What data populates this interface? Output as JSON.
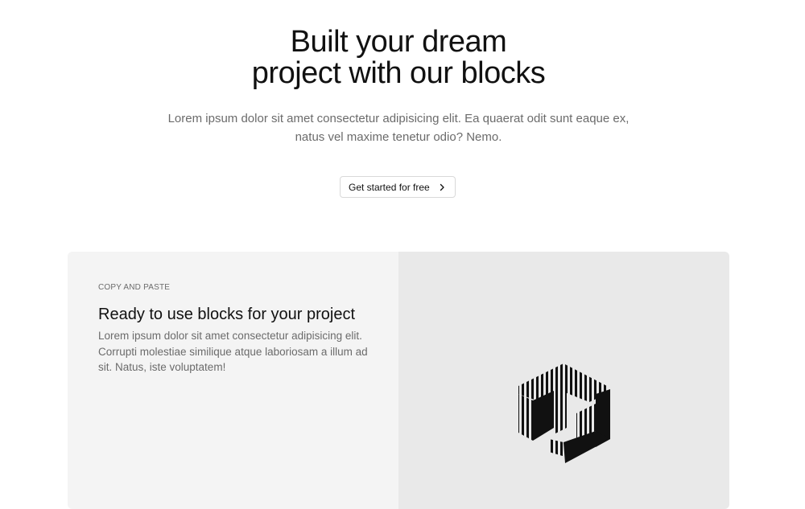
{
  "hero": {
    "title_line1": "Built your dream",
    "title_line2": "project with our blocks",
    "description_line1": "Lorem ipsum dolor sit amet consectetur adipisicing elit. Ea quaerat odit sunt eaque ex,",
    "description_line2": "natus vel maxime tenetur odio? Nemo.",
    "cta_label": "Get started for free",
    "cta_icon": "chevron-right-icon"
  },
  "feature": {
    "eyebrow": "COPY AND PASTE",
    "title": "Ready to use blocks for your project",
    "description": "Lorem ipsum dolor sit amet consectetur adipisicing elit. Corrupti molestiae similique atque laboriosam a illum ad sit. Natus, iste voluptatem!",
    "illustration_icon": "striped-cube-logo-icon"
  },
  "colors": {
    "text_primary": "#111111",
    "text_muted": "#6b6b6b",
    "panel_left": "#f4f4f4",
    "panel_right": "#e9e9e9",
    "button_border": "#d9d9d9"
  }
}
